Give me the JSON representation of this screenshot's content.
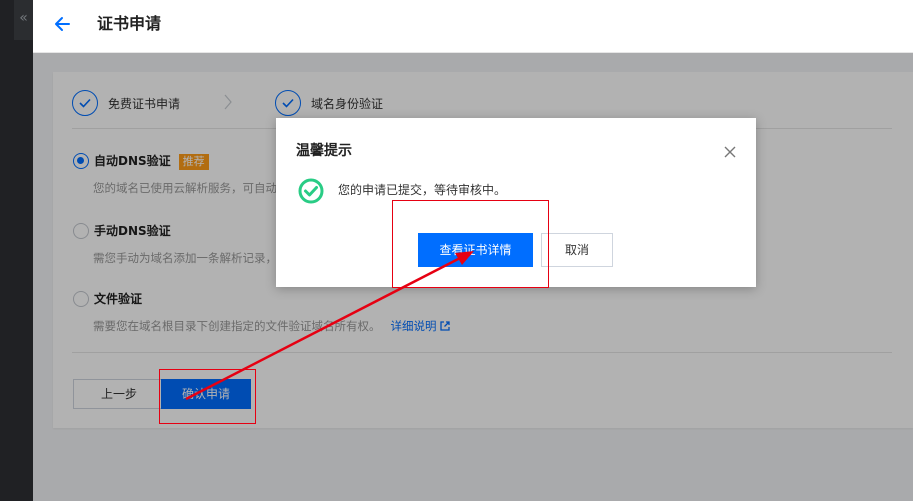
{
  "sidebar": {
    "collapse_icon": "double-chevron-left-icon",
    "collapse_glyph": "«"
  },
  "header": {
    "back_icon": "arrow-left-icon",
    "title": "证书申请"
  },
  "steps": [
    {
      "label": "免费证书申请",
      "status": "done"
    },
    {
      "label": "域名身份验证",
      "status": "done"
    }
  ],
  "options": [
    {
      "title": "自动DNS验证",
      "tag": "推荐",
      "description": "您的域名已使用云解析服务，可自动",
      "selected": true
    },
    {
      "title": "手动DNS验证",
      "description": "需您手动为域名添加一条解析记录，",
      "selected": false
    },
    {
      "title": "文件验证",
      "description": "需要您在域名根目录下创建指定的文件验证域名所有权。",
      "link": "详细说明",
      "selected": false
    }
  ],
  "footer": {
    "prev_label": "上一步",
    "confirm_label": "确认申请"
  },
  "modal": {
    "title": "温馨提示",
    "message": "您的申请已提交，等待审核中。",
    "primary_label": "查看证书详情",
    "cancel_label": "取消",
    "close_icon": "close-icon",
    "status_icon": "success-check-icon"
  },
  "colors": {
    "accent": "#006eff",
    "success": "#29cc85",
    "tag": "#ff9c19",
    "annotation": "#e60012"
  }
}
